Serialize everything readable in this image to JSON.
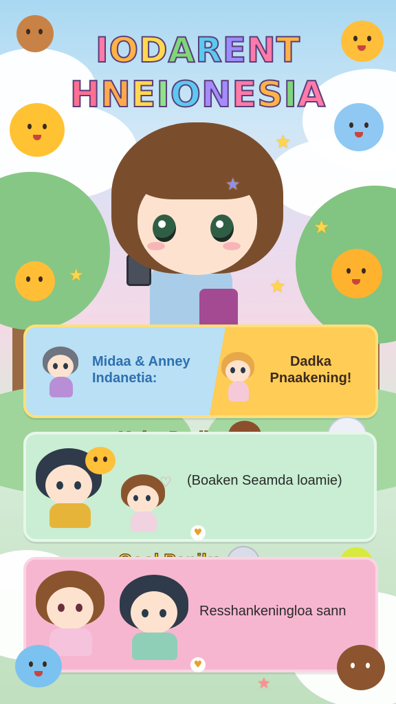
{
  "title": {
    "line1": [
      "I",
      "O",
      "D",
      "A",
      "R",
      "E",
      "N",
      "T"
    ],
    "line2": [
      "H",
      "N",
      "E",
      "I",
      "O",
      "N",
      "E",
      "S",
      "I",
      "A"
    ],
    "line1_colors": [
      "#ff7aa8",
      "#ffb347",
      "#ffd84f",
      "#7fd67a",
      "#5cc9f0",
      "#9b8cff",
      "#ff7aa8",
      "#ffb347"
    ],
    "line2_colors": [
      "#ff6f91",
      "#ffa94d",
      "#ffd84f",
      "#8fe388",
      "#5cc9f0",
      "#a48bff",
      "#ff7aa8",
      "#ffb347",
      "#7fd67a",
      "#ff7aa8"
    ]
  },
  "cards": [
    {
      "left_text": "Midaa & Anney Indanetia:",
      "right_text": "Dadka Pnaakening!"
    },
    {
      "heading": "Huito Dariks",
      "text": "(Boaken Seamda loamie)"
    },
    {
      "heading": "Gool Panika",
      "text": "Resshankeningloa sann"
    }
  ],
  "icons": {
    "card2_heart": "heart-icon",
    "card3_heart": "heart-icon",
    "stars": "star-icon"
  },
  "colors": {
    "heading_yellow": "#ffd23f",
    "text_blue": "#2f6fb0",
    "text_dark": "#3a2a1e"
  }
}
